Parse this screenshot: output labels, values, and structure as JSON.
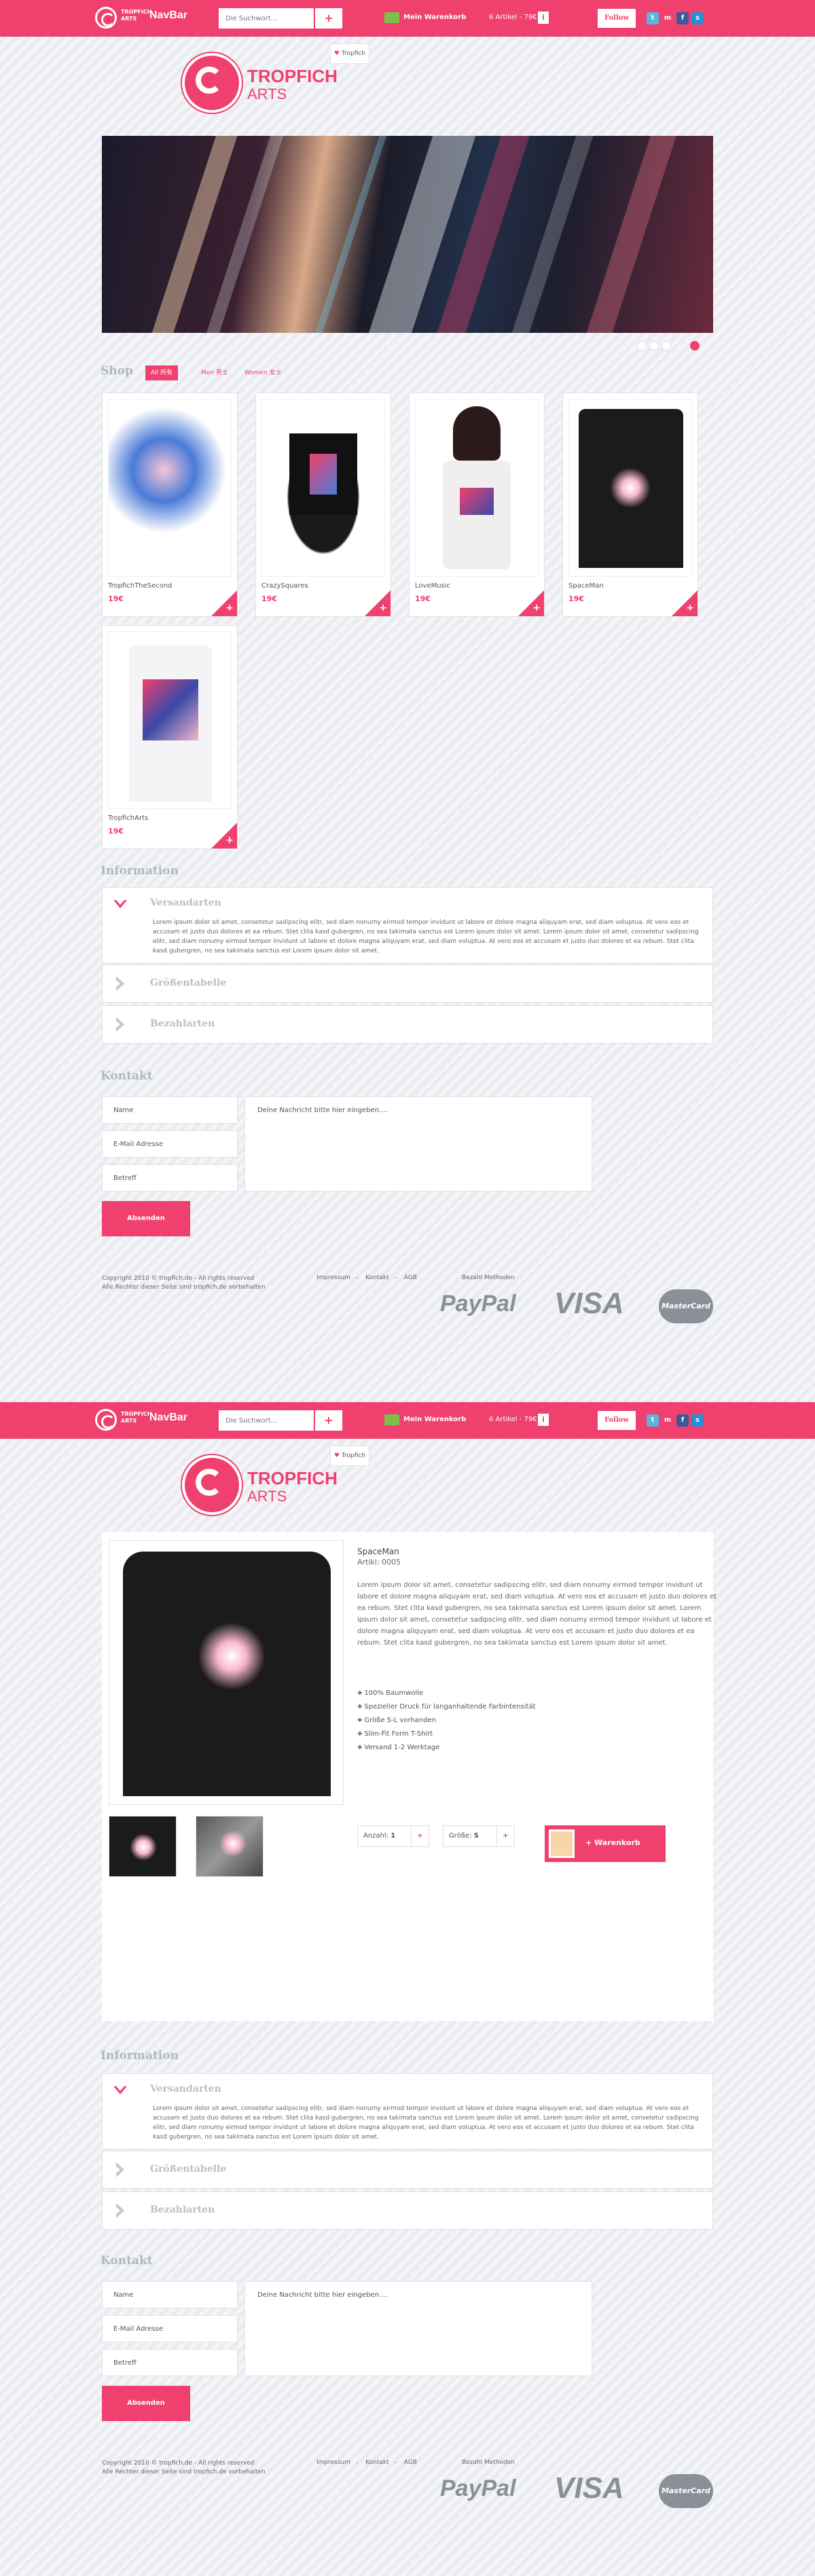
{
  "navbar": {
    "brand_top": "TROPFICH",
    "brand_bottom": "ARTS",
    "title": "NavBar",
    "search_placeholder": "Die Suchwort...",
    "search_button": "+",
    "cart_label": "Mein Warenkorb",
    "cart_count": "6 Artikel - 79€",
    "cart_info": "i",
    "follow_label": "Follow",
    "social_icons": [
      "twitter-icon",
      "myspace-icon",
      "facebook-icon",
      "skype-icon"
    ]
  },
  "brand": {
    "name": "TROPFICH",
    "sub": "ARTS",
    "tag_label": "Tropfich",
    "tag_icon": "heart-icon"
  },
  "shop": {
    "title": "Shop",
    "filters": [
      "All 所有",
      "Men 男士",
      "Women 女士"
    ],
    "products": [
      {
        "name": "TropfichTheSecond",
        "price": "19€"
      },
      {
        "name": "CrazySquares",
        "price": "19€"
      },
      {
        "name": "LoveMusic",
        "price": "19€"
      },
      {
        "name": "SpaceMan",
        "price": "19€"
      },
      {
        "name": "TropfichArts",
        "price": "19€"
      }
    ],
    "add_label": "+"
  },
  "information": {
    "title": "Information",
    "items": [
      {
        "label": "Versandarten",
        "open": true,
        "text": "Lorem ipsum dolor sit amet, consetetur sadipscing elitr, sed diam nonumy eirmod tempor invidunt ut labore et dolore magna aliquyam erat, sed diam voluptua. At vero eos et accusam et justo duo dolores et ea rebum. Stet clita kasd gubergren, no sea takimata sanctus est Lorem ipsum dolor sit amet. Lorem ipsum dolor sit amet, consetetur sadipscing elitr, sed diam nonumy eirmod tempor invidunt ut labore et dolore magna aliquyam erat, sed diam voluptua. At vero eos et accusam et justo duo dolores et ea rebum. Stet clita kasd gubergren, no sea takimata sanctus est Lorem ipsum dolor sit amet."
      },
      {
        "label": "Größentabelle",
        "open": false
      },
      {
        "label": "Bezahlarten",
        "open": false
      }
    ]
  },
  "contact": {
    "title": "Kontakt",
    "name_placeholder": "Name",
    "email_placeholder": "E-Mail Adresse",
    "subject_placeholder": "Betreff",
    "message_placeholder": "Deine Nachricht bitte hier eingeben....",
    "submit_label": "Absenden"
  },
  "footer": {
    "copyright": "Copyright 2010 ©  tropfich.de  -  All rights reserved",
    "rights": "Alle Rechter dieser Seite sind tropfich.de vorbehalten",
    "links": [
      "Impressum",
      "Kontakt",
      "AGB"
    ],
    "separator": "-",
    "payment_label": "Bezahl Methoden",
    "paypal": "PayPal",
    "visa": "VISA",
    "mastercard": "MasterCard"
  },
  "product_detail": {
    "title": "SpaceMan",
    "article": "Artikl: 0005",
    "description": "Lorem ipsum dolor sit amet, consetetur sadipscing elitr, sed diam nonumy eirmod tempor invidunt ut labore et dolore magna aliquyam erat, sed diam voluptua. At vero eos et accusam et justo duo dolores et ea rebum. Stet clita kasd gubergren, no sea takimata sanctus est Lorem ipsum dolor sit amet. Lorem ipsum dolor sit amet, consetetur sadipscing elitr, sed diam nonumy eirmod tempor invidunt ut labore et dolore magna aliquyam erat, sed diam voluptua. At vero eos et accusam et justo duo dolores et ea rebum. Stet clita kasd gubergren, no sea takimata sanctus est Lorem ipsum dolor sit amet.",
    "features": [
      "100% Baumwolle",
      "Spezieller Druck für langanhaltende Farbintensität",
      "Größe S-L vorhanden",
      "Slim-Fit Form T-Shirt",
      "Versand 1-2 Werktage"
    ],
    "quantity_label": "Anzahl:",
    "quantity_value": "1",
    "size_label": "Größe:",
    "size_value": "S",
    "cart_button": "+  Warenkorb"
  },
  "colors": {
    "accent": "#f0406e",
    "heading": "#b0b6c2",
    "background": "#eef0f4"
  }
}
